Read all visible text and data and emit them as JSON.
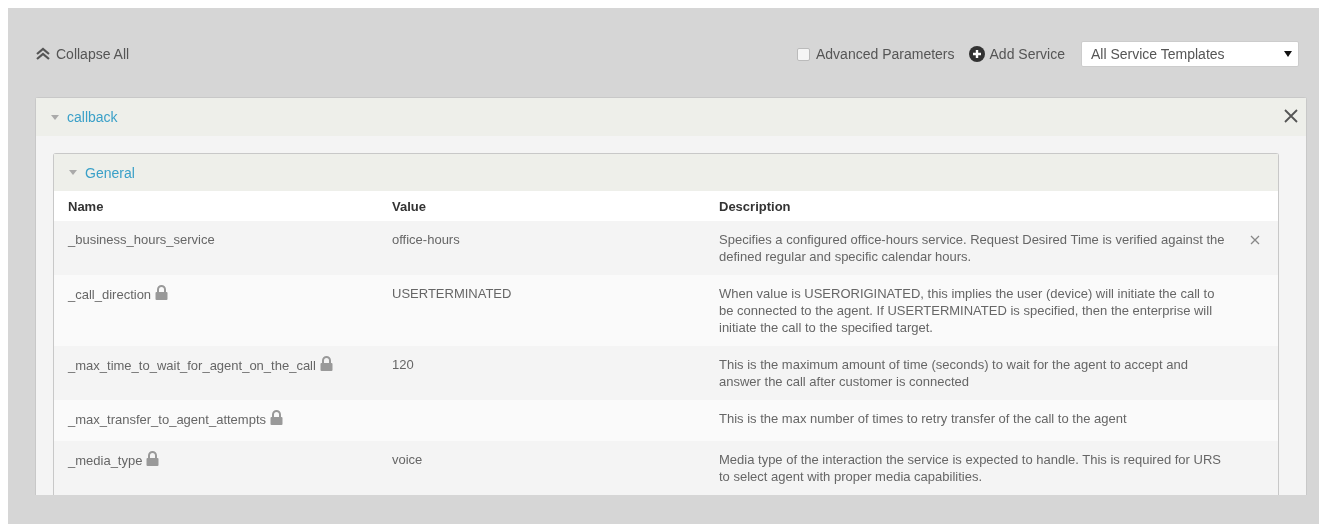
{
  "toolbar": {
    "collapse_all": "Collapse All",
    "advanced_parameters": {
      "label": "Advanced Parameters",
      "checked": false
    },
    "add_service": "Add Service",
    "template_select": {
      "value": "All Service Templates"
    }
  },
  "service": {
    "title": "callback",
    "expanded": true,
    "section": {
      "title": "General",
      "expanded": true,
      "columns": [
        "Name",
        "Value",
        "Description"
      ],
      "rows": [
        {
          "name": "_business_hours_service",
          "locked": false,
          "value": "office-hours",
          "description": "Specifies a configured office-hours service. Request Desired Time is verified against the defined regular and specific calendar hours.",
          "removable": true
        },
        {
          "name": "_call_direction",
          "locked": true,
          "value": "USERTERMINATED",
          "description": "When value is USERORIGINATED, this implies the user (device) will initiate the call to be connected to the agent. If USERTERMINATED is specified, then the enterprise will initiate the call to the specified target.",
          "removable": false
        },
        {
          "name": "_max_time_to_wait_for_agent_on_the_call",
          "locked": true,
          "value": "120",
          "description": "This is the maximum amount of time (seconds) to wait for the agent to accept and answer the call after customer is connected",
          "removable": false
        },
        {
          "name": "_max_transfer_to_agent_attempts",
          "locked": true,
          "description": "This is the max number of times to retry transfer of the call to the agent",
          "removable": false
        },
        {
          "name": "_media_type",
          "locked": true,
          "value": "voice",
          "description": "Media type of the interaction the service is expected to handle. This is required for URS to select agent with proper media capabilities.",
          "removable": false
        }
      ]
    }
  }
}
